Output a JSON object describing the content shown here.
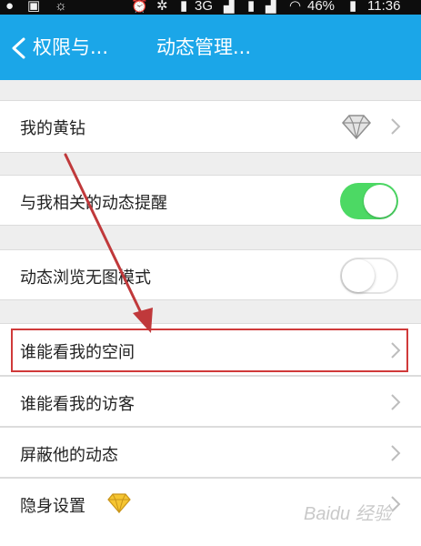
{
  "status_bar": {
    "network": "3G",
    "battery": "46%",
    "time": "11:36"
  },
  "header": {
    "back_label": "权限与...",
    "title": "动态管理..."
  },
  "rows": [
    {
      "label": "我的黄钻"
    },
    {
      "label": "与我相关的动态提醒",
      "toggle": "on"
    },
    {
      "label": "动态浏览无图模式",
      "toggle": "off"
    },
    {
      "label": "谁能看我的空间"
    },
    {
      "label": "谁能看我的访客"
    },
    {
      "label": "屏蔽他的动态"
    },
    {
      "label": "隐身设置"
    }
  ],
  "colors": {
    "header": "#1ba6e8",
    "toggle_on": "#4cd964",
    "highlight": "#d03a3a",
    "arrow": "#c0393b"
  },
  "icons": [
    "back-chevron-icon",
    "diamond-icon",
    "gold-diamond-icon",
    "chevron-right-icon"
  ]
}
